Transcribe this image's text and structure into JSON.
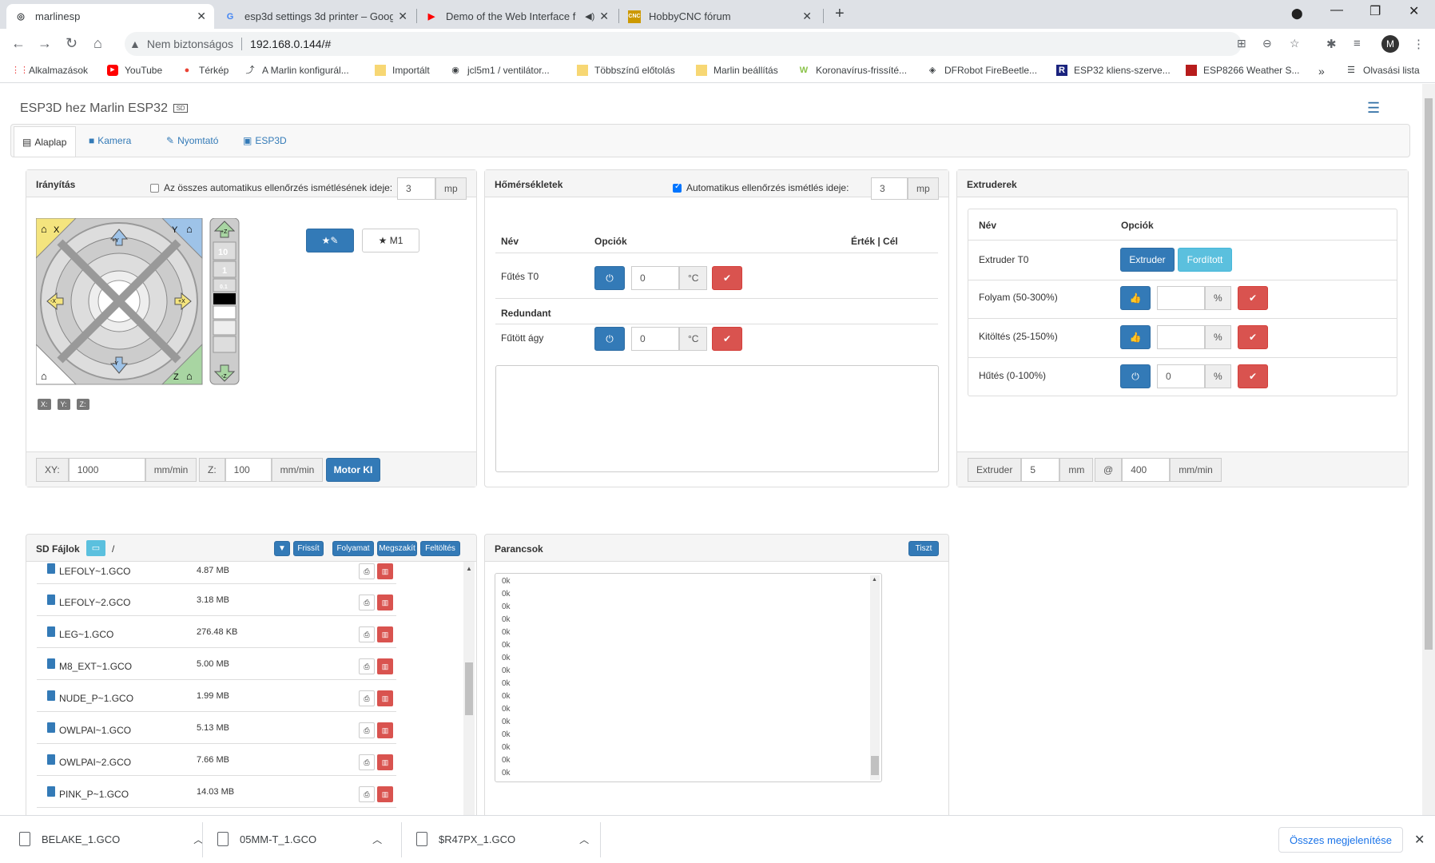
{
  "browser": {
    "tabs": [
      {
        "title": "marlinesp",
        "icon": "globe-icon"
      },
      {
        "title": "esp3d settings 3d printer – Goog",
        "icon": "google-icon"
      },
      {
        "title": "Demo of the Web Interface f",
        "icon": "youtube-icon"
      },
      {
        "title": "HobbyCNC fórum",
        "icon": "cnc-icon"
      }
    ],
    "security": "Nem biztonságos",
    "url": "192.168.0.144/#",
    "avatar": "M",
    "bookmarks": [
      "Alkalmazások",
      "YouTube",
      "Térkép",
      "A Marlin konfigurál...",
      "Importált",
      "jcl5m1 / ventilátor...",
      "Többszínű előtolás",
      "Marlin beállítás",
      "Koronavírus-frissíté...",
      "DFRobot FireBeetle...",
      "ESP32 kliens-szerve...",
      "ESP8266 Weather S..."
    ],
    "reading_list": "Olvasási lista"
  },
  "app": {
    "title": "ESP3D hez Marlin ESP32",
    "title_badge": "SD",
    "tabs": [
      "Alaplap",
      "Kamera",
      "Nyomtató",
      "ESP3D"
    ]
  },
  "control": {
    "title": "Irányítás",
    "auto_label": "Az összes automatikus ellenőrzés ismétlésének ideje:",
    "auto_value": "3",
    "auto_unit": "mp",
    "macro_button": "M1",
    "pos_labels": [
      "X:",
      "Y:",
      "Z:"
    ],
    "jog_labels": {
      "x": "X",
      "y": "Y",
      "z": "Z",
      "zsteps": [
        "10",
        "1",
        "0.1"
      ],
      "plus_x": "+X",
      "minus_x": "-X",
      "plus_y": "+Y",
      "minus_y": "-Y",
      "plus_z": "+Z",
      "minus_z": "-Z"
    },
    "xy_label": "XY:",
    "xy_value": "1000",
    "xy_unit": "mm/min",
    "z_label": "Z:",
    "z_value": "100",
    "z_unit": "mm/min",
    "motor_off": "Motor KI"
  },
  "temps": {
    "title": "Hőmérsékletek",
    "auto_label": "Automatikus ellenőrzés ismétlés ideje:",
    "auto_value": "3",
    "auto_unit": "mp",
    "col_name": "Név",
    "col_options": "Opciók",
    "col_value": "Érték | Cél",
    "rows": [
      {
        "name": "Fűtés T0",
        "value": "0",
        "unit": "°C"
      },
      {
        "name": "Redundant"
      },
      {
        "name": "Fűtött ágy",
        "value": "0",
        "unit": "°C"
      }
    ]
  },
  "extruders": {
    "title": "Extruderek",
    "col_name": "Név",
    "col_options": "Opciók",
    "row0_name": "Extruder T0",
    "btn_extruder": "Extruder",
    "btn_reverse": "Fordított",
    "rows": [
      {
        "name": "Folyam (50-300%)",
        "value": "",
        "unit": "%"
      },
      {
        "name": "Kitöltés (25-150%)",
        "value": "",
        "unit": "%"
      },
      {
        "name": "Hűtés (0-100%)",
        "value": "0",
        "unit": "%"
      }
    ],
    "foot_label": "Extruder",
    "foot_value": "5",
    "foot_unit": "mm",
    "at": "@",
    "speed_value": "400",
    "speed_unit": "mm/min"
  },
  "sd": {
    "title": "SD Fájlok",
    "path": "/",
    "buttons": [
      "Frissít",
      "Folyamat",
      "Megszakít",
      "Feltöltés"
    ],
    "files": [
      {
        "name": "LEFOLY~1.GCO",
        "size": "4.87 MB"
      },
      {
        "name": "LEFOLY~2.GCO",
        "size": "3.18 MB"
      },
      {
        "name": "LEG~1.GCO",
        "size": "276.48 KB"
      },
      {
        "name": "M8_EXT~1.GCO",
        "size": "5.00 MB"
      },
      {
        "name": "NUDE_P~1.GCO",
        "size": "1.99 MB"
      },
      {
        "name": "OWLPAI~1.GCO",
        "size": "5.13 MB"
      },
      {
        "name": "OWLPAI~2.GCO",
        "size": "7.66 MB"
      },
      {
        "name": "PINK_P~1.GCO",
        "size": "14.03 MB"
      }
    ]
  },
  "commands": {
    "title": "Parancsok",
    "clear": "Tiszt",
    "lines": [
      "0k",
      "0k",
      "0k",
      "0k",
      "0k",
      "0k",
      "0k",
      "0k",
      "0k",
      "0k",
      "0k",
      "0k",
      "0k",
      "0k",
      "0k",
      "0k",
      "0k",
      "0k"
    ]
  },
  "downloads": {
    "items": [
      "BELAKE_1.GCO",
      "05MM-T_1.GCO",
      "$R47PX_1.GCO"
    ],
    "show_all": "Összes megjelenítése"
  },
  "colors": {
    "primary": "#337ab7",
    "danger": "#d9534f",
    "info": "#5bc0de"
  }
}
